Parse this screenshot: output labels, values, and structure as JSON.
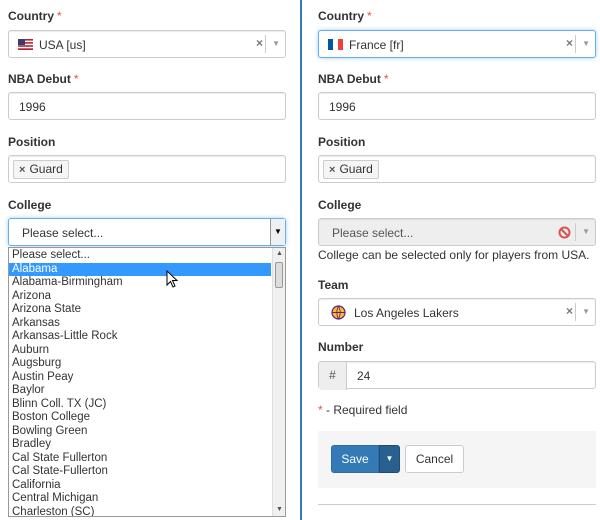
{
  "left": {
    "country": {
      "label": "Country",
      "required": "*",
      "value": "USA [us]",
      "clear": "×"
    },
    "nba_debut": {
      "label": "NBA Debut",
      "required": "*",
      "value": "1996"
    },
    "position": {
      "label": "Position",
      "tag_remove": "×",
      "tag": "Guard"
    },
    "college": {
      "label": "College",
      "placeholder": "Please select...",
      "options": [
        "Please select...",
        "Alabama",
        "Alabama-Birmingham",
        "Arizona",
        "Arizona State",
        "Arkansas",
        "Arkansas-Little Rock",
        "Auburn",
        "Augsburg",
        "Austin Peay",
        "Baylor",
        "Blinn Coll. TX (JC)",
        "Boston College",
        "Bowling Green",
        "Bradley",
        "Cal State Fullerton",
        "Cal State-Fullerton",
        "California",
        "Central Michigan",
        "Charleston (SC)"
      ],
      "highlighted": "Alabama"
    }
  },
  "right": {
    "country": {
      "label": "Country",
      "required": "*",
      "value": "France [fr]",
      "clear": "×"
    },
    "nba_debut": {
      "label": "NBA Debut",
      "required": "*",
      "value": "1996"
    },
    "position": {
      "label": "Position",
      "tag_remove": "×",
      "tag": "Guard"
    },
    "college": {
      "label": "College",
      "placeholder": "Please select...",
      "help": "College can be selected only for players from USA."
    },
    "team": {
      "label": "Team",
      "value": "Los Angeles Lakers",
      "clear": "×"
    },
    "number": {
      "label": "Number",
      "addon": "#",
      "value": "24"
    },
    "required_note": {
      "star": "*",
      "text": " - Required field"
    },
    "buttons": {
      "save": "Save",
      "cancel": "Cancel"
    }
  },
  "colors": {
    "accent": "#337ab7",
    "required": "#d9534f",
    "highlight": "#3399ff"
  },
  "icons": [
    "us-flag-icon",
    "france-flag-icon",
    "lakers-logo-icon",
    "not-allowed-icon",
    "chevron-down-icon",
    "mouse-cursor-icon"
  ]
}
